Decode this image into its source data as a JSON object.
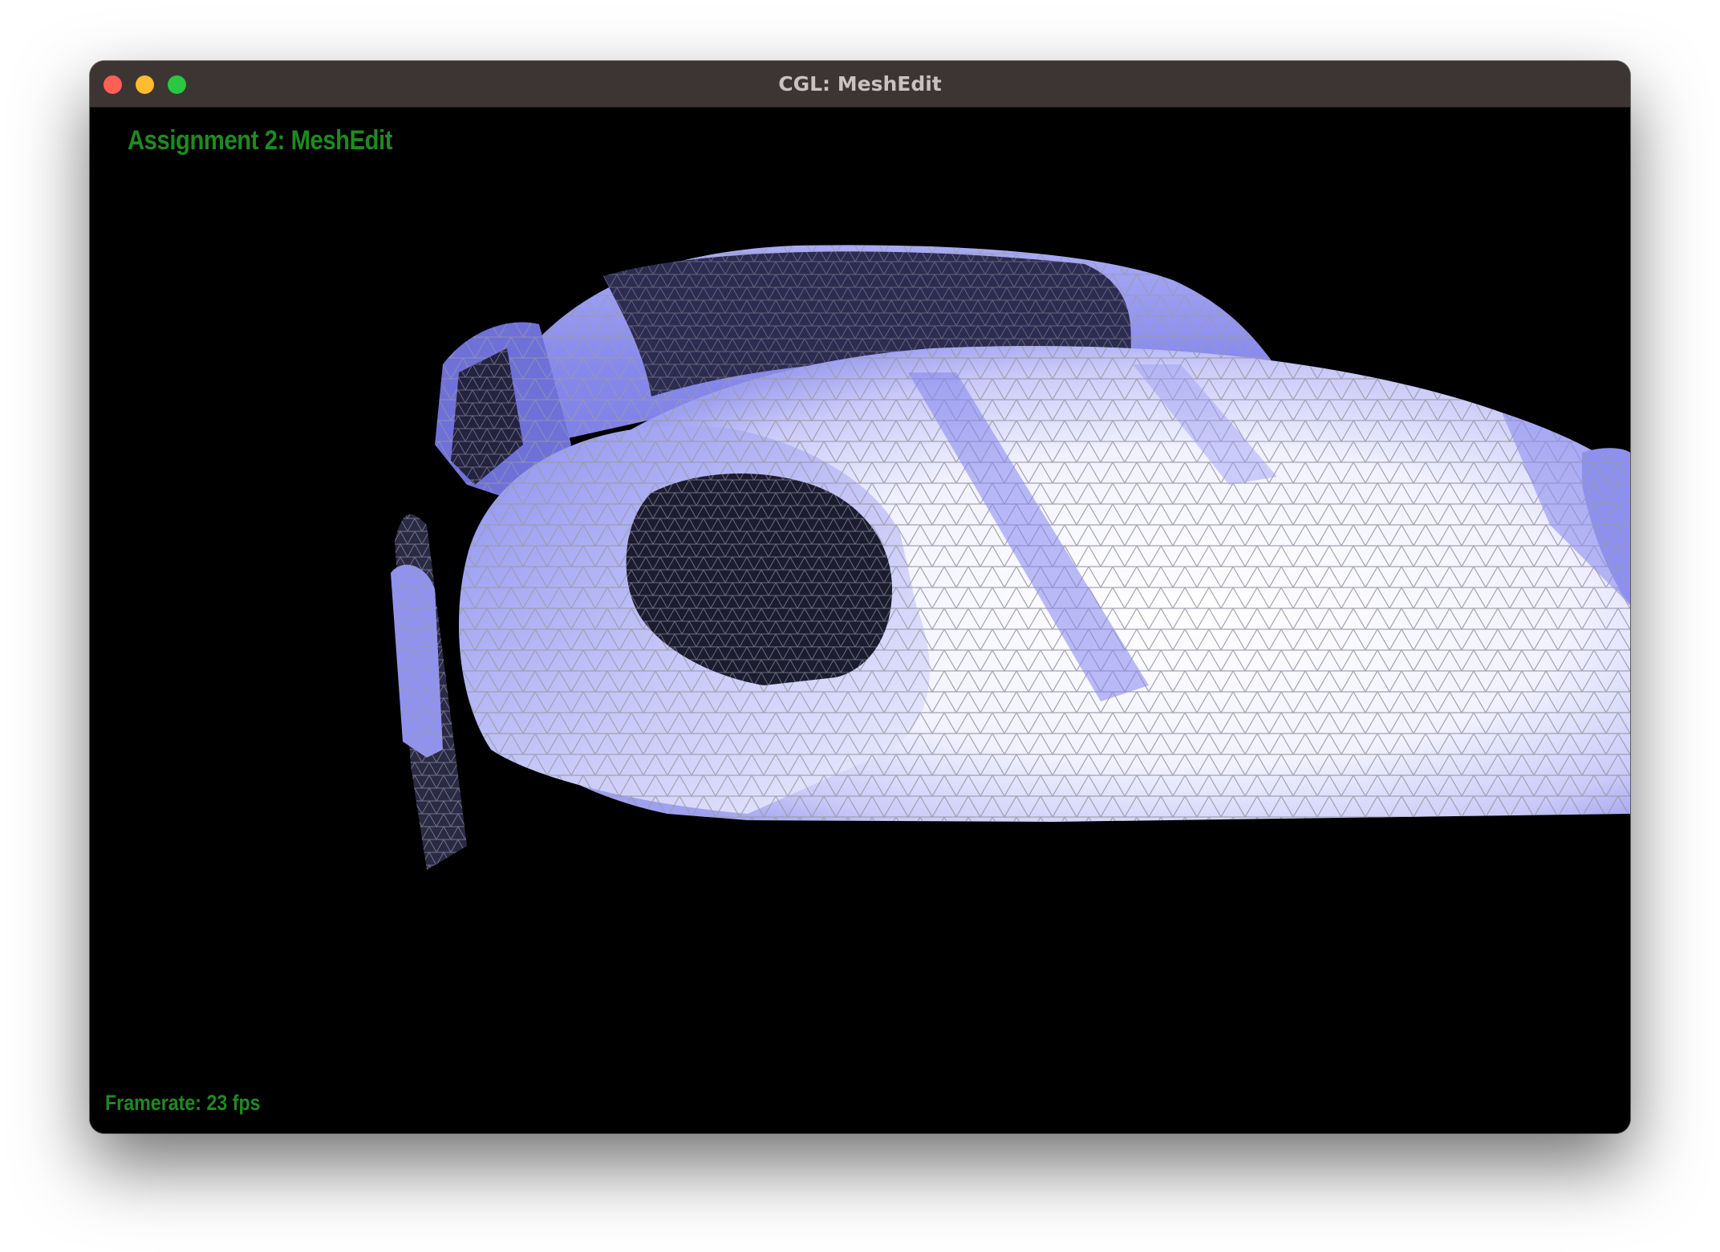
{
  "window": {
    "title": "CGL: MeshEdit",
    "controls": [
      "close-button",
      "minimize-button",
      "zoom-button"
    ]
  },
  "hud": {
    "title": "Assignment 2: MeshEdit",
    "framerate": "Framerate: 23 fps"
  },
  "scene": {
    "background": "#000000",
    "mesh_fill": "#8b8ef0",
    "mesh_highlight": "#ffffff",
    "mesh_interior": "#1e1e30",
    "wireframe_color": "#9a9aa8"
  },
  "colors": {
    "hud_text": "#1f8a22",
    "titlebar": "#3d3534",
    "close": "#fe5f57",
    "minimize": "#febc2e",
    "zoom": "#28c840"
  }
}
